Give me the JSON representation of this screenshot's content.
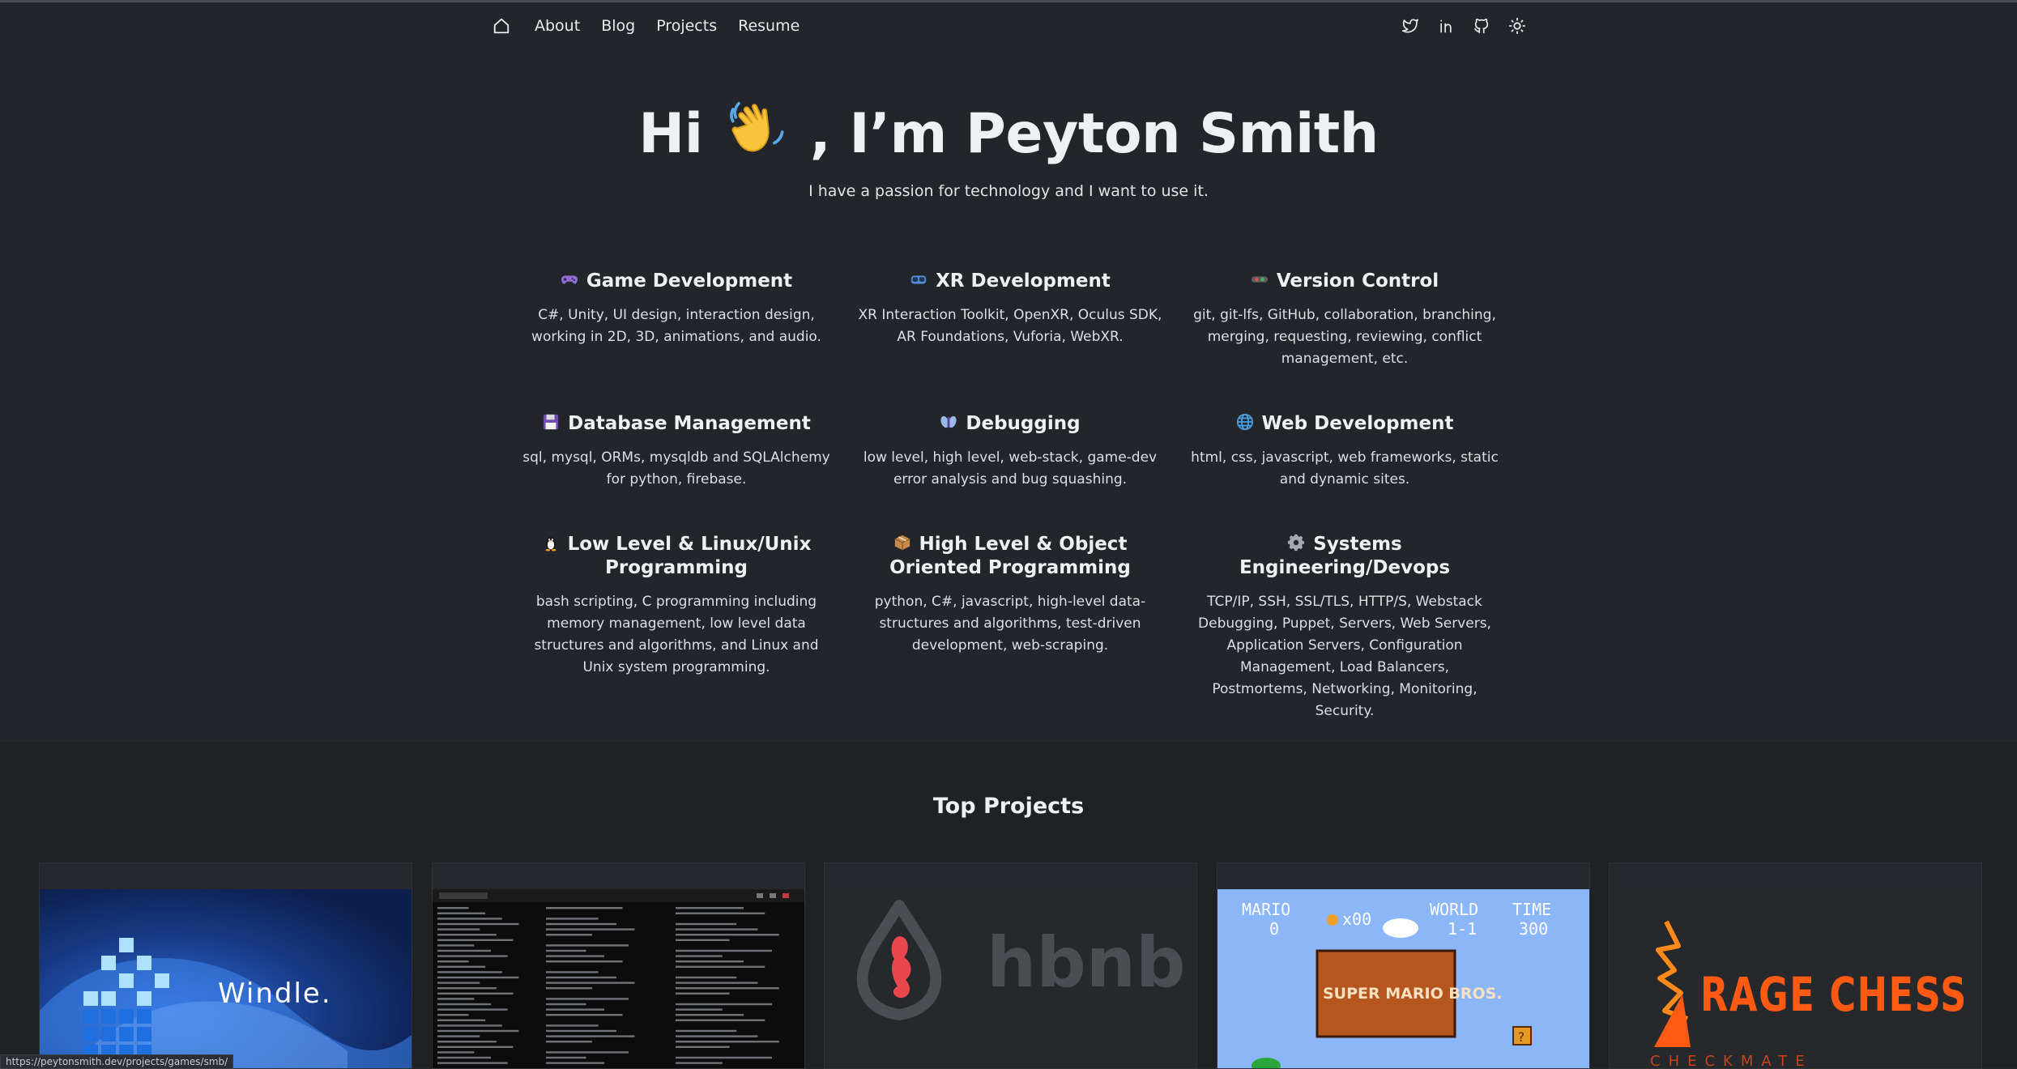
{
  "nav": {
    "links": [
      "About",
      "Blog",
      "Projects",
      "Resume"
    ]
  },
  "hero": {
    "title_before": "Hi",
    "title_after": ", I’m Peyton Smith",
    "subtitle": "I have a passion for technology and I want to use it."
  },
  "skills": [
    {
      "icon": "gamepad-icon",
      "title": "Game Development",
      "desc": "C#, Unity, UI design, interaction design, working in 2D, 3D, animations, and audio."
    },
    {
      "icon": "vr-goggles-icon",
      "title": "XR Development",
      "desc": "XR Interaction Toolkit, OpenXR, Oculus SDK, AR Foundations, Vuforia, WebXR."
    },
    {
      "icon": "git-branch-icon",
      "title": "Version Control",
      "desc": "git, git-lfs, GitHub, collaboration, branching, merging, requesting, reviewing, conflict management, etc."
    },
    {
      "icon": "floppy-disk-icon",
      "title": "Database Management",
      "desc": "sql, mysql, ORMs, mysqldb and SQLAlchemy for python, firebase."
    },
    {
      "icon": "bug-icon",
      "title": "Debugging",
      "desc": "low level, high level, web-stack, game-dev error analysis and bug squashing."
    },
    {
      "icon": "globe-icon",
      "title": "Web Development",
      "desc": "html, css, javascript, web frameworks, static and dynamic sites."
    },
    {
      "icon": "penguin-icon",
      "title": "Low Level & Linux/Unix Programming",
      "desc": "bash scripting, C programming including memory management, low level data structures and algorithms, and Linux and Unix system programming."
    },
    {
      "icon": "package-icon",
      "title": "High Level & Object Oriented Programming",
      "desc": "python, C#, javascript, high-level data-structures and algorithms, test-driven development, web-scraping."
    },
    {
      "icon": "gear-icon",
      "title": "Systems Engineering/Devops",
      "desc": "TCP/IP, SSH, SSL/TLS, HTTP/S, Webstack Debugging, Puppet, Servers, Web Servers, Application Servers, Configuration Management, Load Balancers, Postmortems, Networking, Monitoring, Security."
    }
  ],
  "projects": {
    "title": "Top Projects",
    "cards": [
      {
        "name": "windle-thumbnail",
        "logo_text": "Windle."
      },
      {
        "name": "simple-shell-thumbnail"
      },
      {
        "name": "hbnb-thumbnail",
        "logo_text": "hbnb"
      },
      {
        "name": "super-mario-bros-thumbnail",
        "hud": [
          "MARIO",
          "0",
          "x00",
          "WORLD",
          "1-1",
          "TIME",
          "300"
        ],
        "logo_text": "SUPER MARIO BROS."
      },
      {
        "name": "rage-chess-thumbnail",
        "logo_text": "RAGE CHESS",
        "sub_text": "CHECKMATE"
      }
    ]
  },
  "status_bar": {
    "url": "https://peytonsmith.dev/projects/games/smb/"
  },
  "colors": {
    "background": "#222529",
    "band": "#1f2124",
    "text": "#e7e9ec",
    "hbnb_accent": "#e8484d",
    "chess_accent": "#ff5a14",
    "mario_sky": "#8bb6f8"
  }
}
